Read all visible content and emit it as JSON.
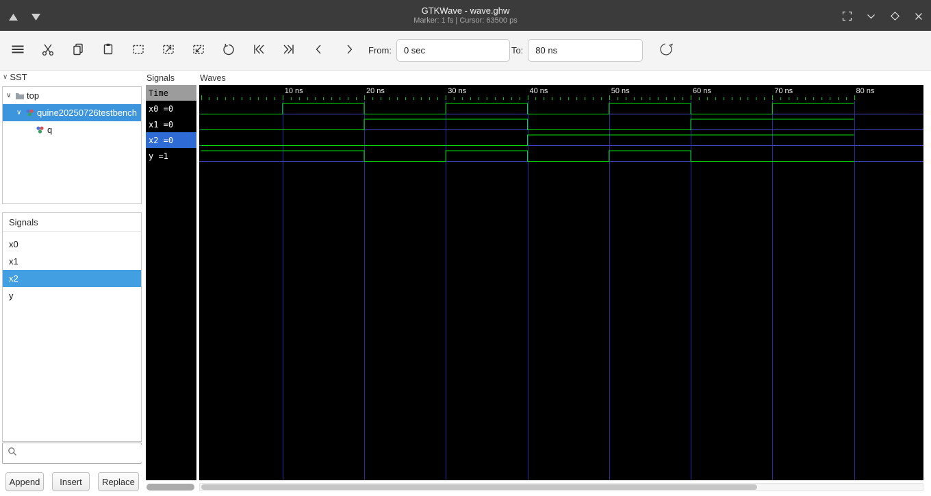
{
  "window": {
    "title": "GTKWave - wave.ghw",
    "status": "Marker: 1 fs | Cursor: 63500 ps"
  },
  "toolbar": {
    "from_label": "From:",
    "from_value": "0 sec",
    "to_label": "To:",
    "to_value": "80 ns"
  },
  "sst": {
    "header": "SST",
    "tree": [
      {
        "label": "top",
        "icon": "folder-icon",
        "level": 0,
        "expanded": true,
        "selected": false
      },
      {
        "label": "quine20250726testbench",
        "icon": "module-icon",
        "level": 1,
        "expanded": true,
        "selected": true
      },
      {
        "label": "q",
        "icon": "module-icon",
        "level": 2,
        "expanded": false,
        "selected": false
      }
    ],
    "signals_header": "Signals",
    "signal_list": [
      {
        "name": "x0",
        "selected": false
      },
      {
        "name": "x1",
        "selected": false
      },
      {
        "name": "x2",
        "selected": true
      },
      {
        "name": "y",
        "selected": false
      }
    ],
    "search_value": "",
    "buttons": [
      {
        "label": "Append"
      },
      {
        "label": "Insert"
      },
      {
        "label": "Replace"
      }
    ]
  },
  "names_panel": {
    "title": "Signals",
    "time_header": "Time"
  },
  "waves_panel": {
    "title": "Waves"
  },
  "chart_data": {
    "type": "digital-waveform",
    "time_unit": "ns",
    "t_start": 0,
    "t_end": 80,
    "major_tick_ns": 10,
    "marker": "1 fs",
    "cursor": "63500 ps",
    "ticks": [
      {
        "t": 10,
        "label": "10 ns"
      },
      {
        "t": 20,
        "label": "20 ns"
      },
      {
        "t": 30,
        "label": "30 ns"
      },
      {
        "t": 40,
        "label": "40 ns"
      },
      {
        "t": 50,
        "label": "50 ns"
      },
      {
        "t": 60,
        "label": "60 ns"
      },
      {
        "t": 70,
        "label": "70 ns"
      },
      {
        "t": 80,
        "label": "80 ns"
      }
    ],
    "signals": [
      {
        "name": "x0",
        "value_at_marker": "0",
        "selected": false,
        "wave": [
          [
            0,
            0
          ],
          [
            10,
            1
          ],
          [
            20,
            0
          ],
          [
            30,
            1
          ],
          [
            40,
            0
          ],
          [
            50,
            1
          ],
          [
            60,
            0
          ],
          [
            70,
            1
          ],
          [
            80,
            1
          ]
        ]
      },
      {
        "name": "x1",
        "value_at_marker": "0",
        "selected": false,
        "wave": [
          [
            0,
            0
          ],
          [
            20,
            1
          ],
          [
            40,
            0
          ],
          [
            60,
            1
          ],
          [
            80,
            1
          ]
        ]
      },
      {
        "name": "x2",
        "value_at_marker": "0",
        "selected": true,
        "wave": [
          [
            0,
            0
          ],
          [
            40,
            1
          ],
          [
            80,
            1
          ]
        ]
      },
      {
        "name": "y",
        "value_at_marker": "1",
        "selected": false,
        "wave": [
          [
            0,
            1
          ],
          [
            20,
            0
          ],
          [
            30,
            1
          ],
          [
            40,
            0
          ],
          [
            50,
            1
          ],
          [
            60,
            0
          ],
          [
            80,
            0
          ]
        ]
      }
    ],
    "colors": {
      "wave": "#00e600",
      "grid": "#2929a3",
      "baseline": "#4646cc",
      "background": "#000000",
      "tick": "#00c800",
      "selection": "#2e6bd4"
    }
  }
}
